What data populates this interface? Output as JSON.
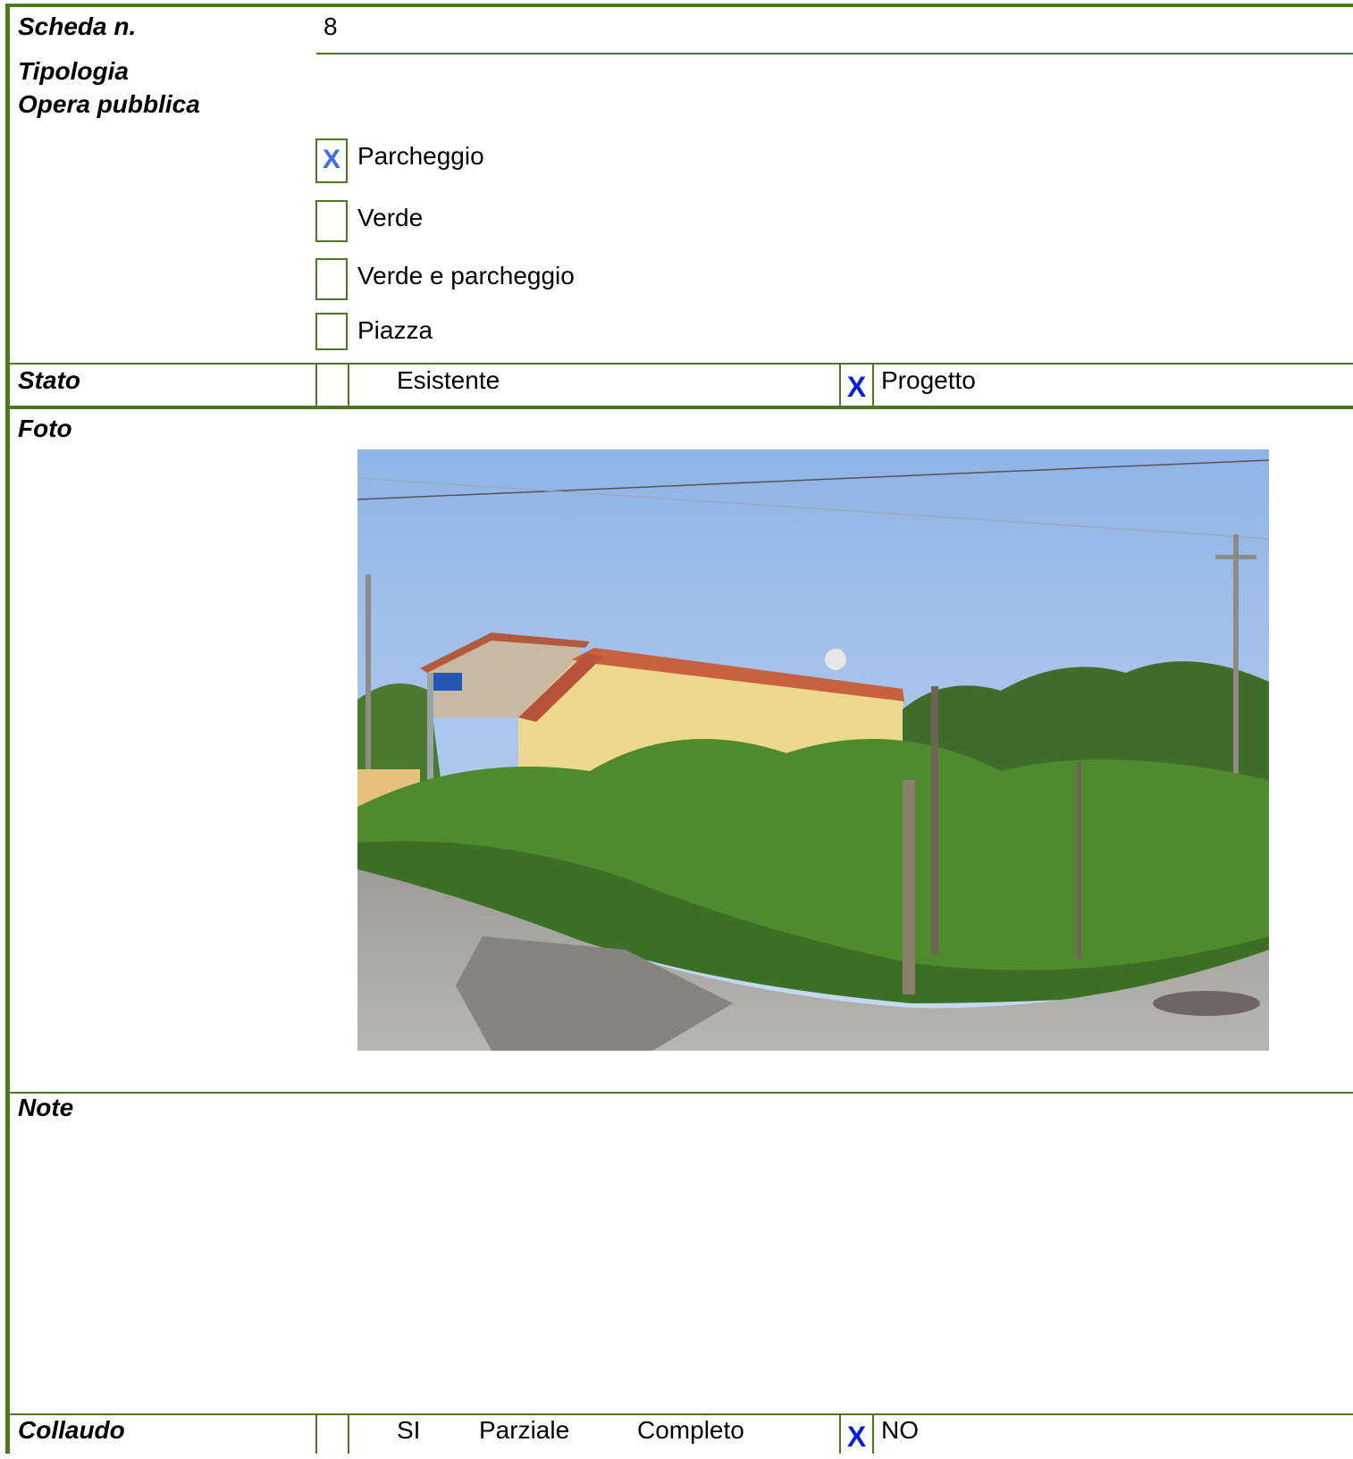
{
  "scheda": {
    "label": "Scheda n.",
    "value": "8"
  },
  "tipologia": {
    "label_line1": "Tipologia",
    "label_line2": "Opera pubblica",
    "options": [
      {
        "label": "Parcheggio",
        "checked": true,
        "mark": "X"
      },
      {
        "label": "Verde",
        "checked": false,
        "mark": ""
      },
      {
        "label": "Verde e parcheggio",
        "checked": false,
        "mark": ""
      },
      {
        "label": "Piazza",
        "checked": false,
        "mark": ""
      }
    ]
  },
  "stato": {
    "label": "Stato",
    "esistente": {
      "label": "Esistente",
      "mark": ""
    },
    "progetto": {
      "label": "Progetto",
      "mark": "X"
    }
  },
  "foto": {
    "label": "Foto"
  },
  "note": {
    "label": "Note",
    "text": ""
  },
  "collaudo": {
    "label": "Collaudo",
    "si_label": "SI",
    "parziale_label": "Parziale",
    "completo_label": "Completo",
    "no": {
      "label": "NO",
      "mark": "X"
    }
  },
  "colors": {
    "border": "#4a7a1e",
    "mark_light": "#3b6ee8",
    "mark_dark": "#0a1fd6"
  }
}
